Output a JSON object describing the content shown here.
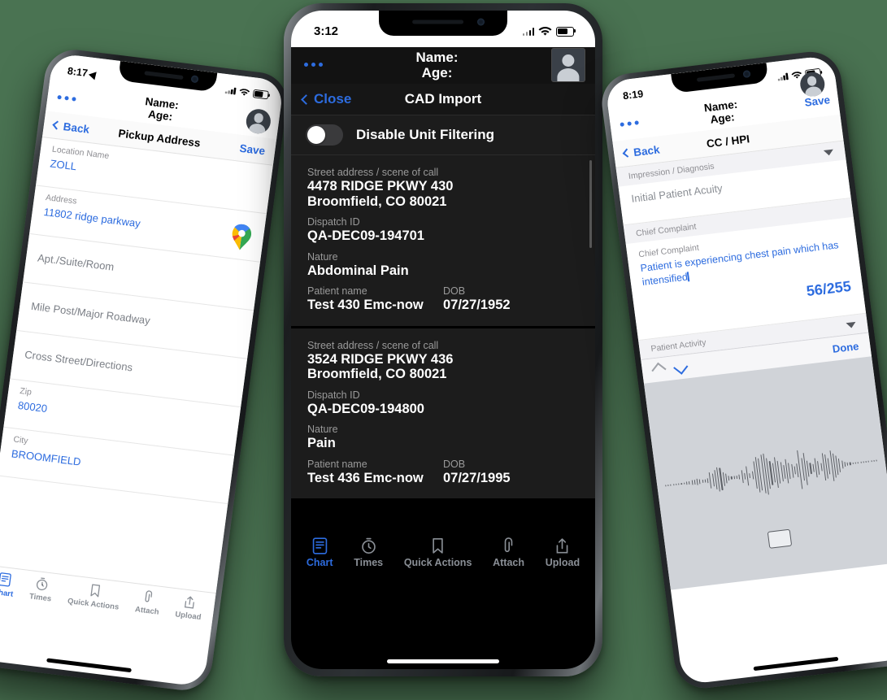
{
  "background_color": "#4a7352",
  "accent_color": "#2d6cdf",
  "phone_left": {
    "status_bar": {
      "time": "8:17",
      "location_icon": "location-arrow-icon",
      "signal": "cellular-signal-icon",
      "wifi": "wifi-icon",
      "battery": "battery-icon"
    },
    "app_bar": {
      "menu": "overflow-menu-icon",
      "name_label": "Name:",
      "age_label": "Age:",
      "avatar": "user-avatar-icon"
    },
    "nav_bar": {
      "back": "Back",
      "title": "Pickup Address",
      "save": "Save"
    },
    "form": [
      {
        "label": "Location Name",
        "value": "ZOLL",
        "placeholder": "",
        "filled": true
      },
      {
        "label": "Address",
        "value": "11802 ridge parkway",
        "placeholder": "",
        "filled": true,
        "trailing_icon": "google-maps-pin-icon"
      },
      {
        "label": "",
        "value": "",
        "placeholder": "Apt./Suite/Room",
        "filled": false
      },
      {
        "label": "",
        "value": "",
        "placeholder": "Mile Post/Major Roadway",
        "filled": false
      },
      {
        "label": "",
        "value": "",
        "placeholder": "Cross Street/Directions",
        "filled": false
      },
      {
        "label": "Zip",
        "value": "80020",
        "placeholder": "",
        "filled": true
      },
      {
        "label": "City",
        "value": "BROOMFIELD",
        "placeholder": "",
        "filled": true
      }
    ],
    "tab_bar": [
      {
        "label": "Chart",
        "icon": "chart-document-icon",
        "active": true
      },
      {
        "label": "Times",
        "icon": "stopwatch-icon",
        "active": false
      },
      {
        "label": "Quick Actions",
        "icon": "bookmark-icon",
        "active": false
      },
      {
        "label": "Attach",
        "icon": "paperclip-icon",
        "active": false
      },
      {
        "label": "Upload",
        "icon": "upload-share-icon",
        "active": false
      }
    ]
  },
  "phone_center": {
    "status_bar": {
      "time": "3:12",
      "signal": "cellular-signal-icon",
      "wifi": "wifi-icon",
      "battery": "battery-icon"
    },
    "app_bar": {
      "menu": "overflow-menu-icon",
      "name_label": "Name:",
      "age_label": "Age:",
      "avatar": "user-avatar-icon"
    },
    "nav_bar": {
      "close": "Close",
      "title": "CAD Import"
    },
    "toggle": {
      "label": "Disable Unit Filtering",
      "state": "off"
    },
    "records": [
      {
        "address_label": "Street address / scene of call",
        "address_line1": "4478 RIDGE PKWY 430",
        "address_line2": "Broomfield, CO 80021",
        "dispatch_label": "Dispatch ID",
        "dispatch_id": "QA-DEC09-194701",
        "nature_label": "Nature",
        "nature": "Abdominal Pain",
        "patient_label": "Patient name",
        "patient_name": "Test 430 Emc-now",
        "dob_label": "DOB",
        "dob": "07/27/1952"
      },
      {
        "address_label": "Street address / scene of call",
        "address_line1": "3524 RIDGE PKWY 436",
        "address_line2": "Broomfield, CO 80021",
        "dispatch_label": "Dispatch ID",
        "dispatch_id": "QA-DEC09-194800",
        "nature_label": "Nature",
        "nature": "Pain",
        "patient_label": "Patient name",
        "patient_name": "Test 436 Emc-now",
        "dob_label": "DOB",
        "dob": "07/27/1995"
      }
    ],
    "tab_bar": [
      {
        "label": "Chart",
        "icon": "chart-document-icon",
        "active": true
      },
      {
        "label": "Times",
        "icon": "stopwatch-icon",
        "active": false
      },
      {
        "label": "Quick Actions",
        "icon": "bookmark-icon",
        "active": false
      },
      {
        "label": "Attach",
        "icon": "paperclip-icon",
        "active": false
      },
      {
        "label": "Upload",
        "icon": "upload-share-icon",
        "active": false
      }
    ]
  },
  "phone_right": {
    "status_bar": {
      "time": "8:19",
      "signal": "cellular-signal-icon",
      "wifi": "wifi-icon",
      "battery": "battery-icon"
    },
    "app_bar": {
      "menu": "overflow-menu-icon",
      "name_label": "Name:",
      "age_label": "Age:",
      "save": "Save",
      "avatar": "user-avatar-icon"
    },
    "nav_bar": {
      "back": "Back",
      "title": "CC / HPI"
    },
    "sections": [
      {
        "header": "Impression / Diagnosis",
        "caret": "chevron-down-icon"
      },
      {
        "header": "Chief Complaint",
        "caret": ""
      }
    ],
    "acuity_row": {
      "placeholder": "Initial Patient Acuity"
    },
    "chief_complaint": {
      "label": "Chief Complaint",
      "value": "Patient is experiencing chest pain which has intensified",
      "counter": "56/255"
    },
    "patient_activity": {
      "header": "Patient Activity",
      "caret": "chevron-down-icon"
    },
    "accessory_bar": {
      "prev": "chevron-up-icon",
      "next": "chevron-down-icon",
      "done": "Done"
    },
    "dictation": {
      "keyboard_icon": "keyboard-icon",
      "waveform": "audio-waveform"
    }
  }
}
